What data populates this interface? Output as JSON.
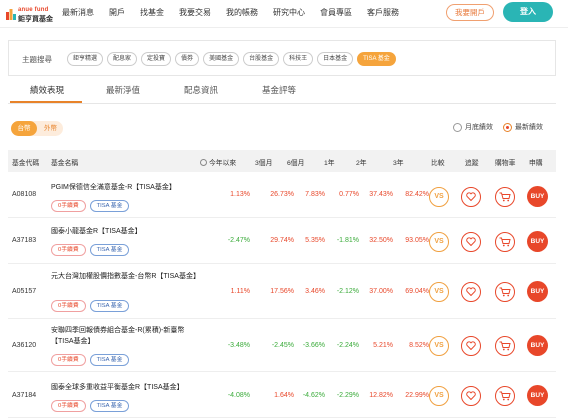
{
  "header": {
    "logo_top": "anue fund",
    "logo_bottom": "鉅亨買基金",
    "nav": [
      "最新消息",
      "開戶",
      "找基金",
      "我要交易",
      "我的帳務",
      "研究中心",
      "會員專區",
      "客戶服務"
    ],
    "open_account": "我要開戶",
    "login": "登入"
  },
  "topics": {
    "label": "主題搜尋",
    "tags": [
      "鉅亨精選",
      "配息家",
      "定投寶",
      "債券",
      "美國基金",
      "台股基金",
      "科技王",
      "日本基金",
      "TISA 基金"
    ],
    "active_index": 8
  },
  "tabs": [
    "績效表現",
    "最新淨值",
    "配息資訊",
    "基金評等"
  ],
  "currency": {
    "tw": "台幣",
    "fx": "外幣"
  },
  "radios": [
    {
      "label": "月底績效",
      "checked": false
    },
    {
      "label": "最新績效",
      "checked": true
    }
  ],
  "table": {
    "headers": {
      "code": "基金代碼",
      "name": "基金名稱",
      "ytd": "今年以來",
      "m3": "3個月",
      "m6": "6個月",
      "y1": "1年",
      "y2": "2年",
      "y3": "3年",
      "compare": "比較",
      "track": "追蹤",
      "cart": "購物車",
      "apply": "申購"
    },
    "fee_badge": "0手續費",
    "tisa_badge": "TISA 基金",
    "vs_label": "VS",
    "buy_label": "BUY",
    "rows": [
      {
        "code": "A08108",
        "name": "PGIM保德信全滿意基金-R【TISA基金】",
        "ytd": "1.13%",
        "m3": "26.73%",
        "m6": "7.83%",
        "y1": "0.77%",
        "y2": "37.43%",
        "y3": "82.42%"
      },
      {
        "code": "A37183",
        "name": "國泰小龍基金R【TISA基金】",
        "ytd": "-2.47%",
        "m3": "29.74%",
        "m6": "5.35%",
        "y1": "-1.81%",
        "y2": "32.50%",
        "y3": "93.05%"
      },
      {
        "code": "A05157",
        "name": "元大台灣加權股價指數基金-台幣R【TISA基金】",
        "ytd": "1.11%",
        "m3": "17.56%",
        "m6": "3.46%",
        "y1": "-2.12%",
        "y2": "37.00%",
        "y3": "69.04%"
      },
      {
        "code": "A36120",
        "name": "安聯四季回報債券組合基金-R(累積)-新臺幣【TISA基金】",
        "ytd": "-3.48%",
        "m3": "-2.45%",
        "m6": "-3.66%",
        "y1": "-2.24%",
        "y2": "5.21%",
        "y3": "8.52%"
      },
      {
        "code": "A37184",
        "name": "國泰全球多重收益平衡基金R【TISA基金】",
        "ytd": "-4.08%",
        "m3": "1.64%",
        "m6": "-4.62%",
        "y1": "-2.29%",
        "y2": "12.82%",
        "y3": "22.99%"
      }
    ]
  }
}
